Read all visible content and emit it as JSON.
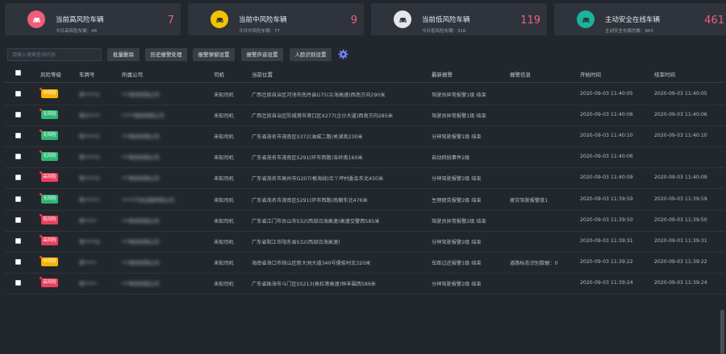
{
  "colors": {
    "high": "#ef5f7a",
    "mid": "#f2c400",
    "low": "#dfe1e4",
    "active": "#1ab39d",
    "badge_high": "#e8415f",
    "badge_mid": "#f5b300",
    "badge_none": "#2fb574",
    "accent": "#6f86ff"
  },
  "cards": [
    {
      "title": "当前高风险车辆",
      "sub_label": "今日高风险车辆：",
      "sub_value": "48",
      "value": "7",
      "icon": "car-icon",
      "color": "#ef5f7a"
    },
    {
      "title": "当前中风险车辆",
      "sub_label": "今日中风险车辆：",
      "sub_value": "77",
      "value": "9",
      "icon": "car-icon",
      "color": "#f2c400"
    },
    {
      "title": "当前低风险车辆",
      "sub_label": "今日低风险车辆：",
      "sub_value": "316",
      "value": "119",
      "icon": "car-icon",
      "color": "#e4e6e9"
    },
    {
      "title": "主动安全在线车辆",
      "sub_label": "主动安全车辆总数：",
      "sub_value": "865",
      "value": "461",
      "icon": "car-icon",
      "color": "#1ab39d"
    }
  ],
  "toolbar": {
    "search_placeholder": "请输入搜索查询内容",
    "buttons": [
      "批量删除",
      "历史报警处理",
      "报警弹窗设置",
      "报警声音设置",
      "人脸识别设置"
    ],
    "settings_icon": "gear-icon"
  },
  "table": {
    "headers": [
      "风险等级",
      "车牌号",
      "所属公司",
      "司机",
      "当前位置",
      "最新报警",
      "报警信息",
      "开始时间",
      "结束时间"
    ],
    "rows": [
      {
        "level": "中风险",
        "level_color": "#f5b300",
        "plate": "粤*****5",
        "company": "***物流有限公司",
        "driver": "未知司机",
        "location": "广西壮族自治区河池市南丹县G75(兰海高速)西南方向290米",
        "alarm": "驾驶员异常报警1级 结束",
        "info": "",
        "start": "2020-09-03 11:40:05",
        "end": "2020-09-03 11:40:05"
      },
      {
        "level": "无风险",
        "level_color": "#2fb574",
        "plate": "粤H*****",
        "company": "*****物流有限公司",
        "driver": "未知司机",
        "location": "广西壮族自治区防城港市港口区X277(企沙大道)西南方向285米",
        "alarm": "驾驶员异常报警1级 结束",
        "info": "",
        "start": "2020-09-03 11:40:06",
        "end": "2020-09-03 11:40:06"
      },
      {
        "level": "无风险",
        "level_color": "#2fb574",
        "plate": "粤*****5",
        "company": "***物流有限公司",
        "driver": "未知司机",
        "location": "广东省茂名市茂南区S372(油城二路)关湖南230米",
        "alarm": "分神驾驶报警1级 结束",
        "info": "",
        "start": "2020-09-03 11:40:10",
        "end": "2020-09-03 11:40:10"
      },
      {
        "level": "无风险",
        "level_color": "#2fb574",
        "plate": "粤*****3",
        "company": "***物流有限公司",
        "driver": "未知司机",
        "location": "广东省茂名市茂南区S291(环市西路)玉岭南160米",
        "alarm": "自动抓拍事件2级",
        "info": "",
        "start": "2020-09-03 11:40:06",
        "end": ""
      },
      {
        "level": "高风险",
        "level_color": "#e8415f",
        "plate": "粤*****5",
        "company": "***物流有限公司",
        "driver": "未知司机",
        "location": "广东省茂名市高州市G207(根海线)合丫坪村委会东北450米",
        "alarm": "分神驾驶报警2级 结束",
        "info": "",
        "start": "2020-09-03 11:40:09",
        "end": "2020-09-03 11:40:09"
      },
      {
        "level": "无风险",
        "level_color": "#2fb574",
        "plate": "粤*****7",
        "company": "*****汽车运输有限公司",
        "driver": "未知司机",
        "location": "广东省茂名市茂南区S291(环市西路)南榭东北476米",
        "alarm": "生理疲劳报警2级 结束",
        "info": "疲劳驾驶报警度1",
        "start": "2020-09-03 11:39:59",
        "end": "2020-09-03 11:39:59"
      },
      {
        "level": "低风险",
        "level_color": "#e8415f",
        "plate": "粤*****",
        "company": "***物流有限公司",
        "driver": "未知司机",
        "location": "广东省江门市台山市S32(西部沿海高速)高速交警西585米",
        "alarm": "驾驶员异常报警2级 结束",
        "info": "",
        "start": "2020-09-03 11:39:50",
        "end": "2020-09-03 11:39:50"
      },
      {
        "level": "高风险",
        "level_color": "#e8415f",
        "plate": "粤*****8",
        "company": "***物流有限公司",
        "driver": "未知司机",
        "location": "广东省阳江市阳东县S32(西部沿海高速)",
        "alarm": "分神驾驶报警2级 结束",
        "info": "",
        "start": "2020-09-03 11:39:31",
        "end": "2020-09-03 11:39:31"
      },
      {
        "level": "中风险",
        "level_color": "#f5b300",
        "plate": "粤*****",
        "company": "***物流有限公司",
        "driver": "未知司机",
        "location": "海南省海口市琼山区新大洲大道340号儒俊村北320米",
        "alarm": "车距过近报警1级 结束",
        "info": "道路标志识别数据：0",
        "start": "2020-09-03 11:39:22",
        "end": "2020-09-03 11:39:22"
      },
      {
        "level": "高风险",
        "level_color": "#e8415f",
        "plate": "粤*****",
        "company": "***物流有限公司",
        "driver": "未知司机",
        "location": "广东省珠海市斗门区S5213(高栏港高速)恒丰围西589米",
        "alarm": "分神驾驶报警2级 结束",
        "info": "",
        "start": "2020-09-03 11:39:24",
        "end": "2020-09-03 11:39:24"
      }
    ]
  }
}
